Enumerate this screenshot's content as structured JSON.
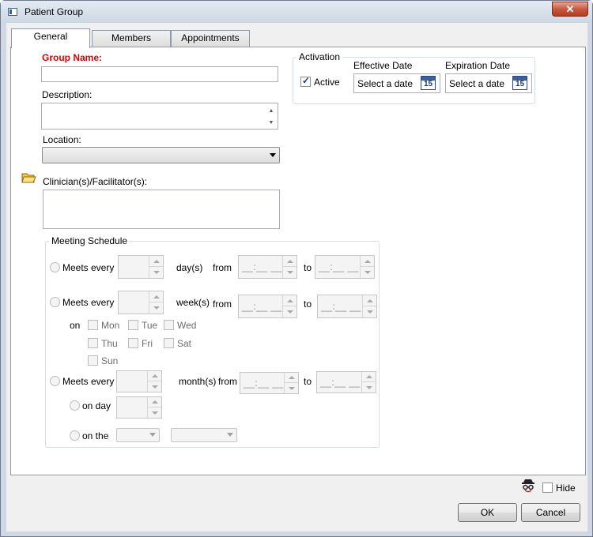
{
  "window": {
    "title": "Patient Group",
    "close_glyph": "✕"
  },
  "tabs": [
    {
      "label": "General"
    },
    {
      "label": "Members"
    },
    {
      "label": "Appointments"
    }
  ],
  "form": {
    "group_name_label": "Group Name:",
    "group_name_value": "",
    "description_label": "Description:",
    "description_value": "",
    "location_label": "Location:",
    "location_value": "",
    "clinicians_label": "Clinician(s)/Facilitator(s):",
    "clinicians_value": ""
  },
  "activation": {
    "title": "Activation",
    "active_label": "Active",
    "active_checked": true,
    "effective_date_label": "Effective Date",
    "expiration_date_label": "Expiration Date",
    "date_placeholder": "Select a date",
    "calendar_day": "15"
  },
  "schedule": {
    "title": "Meeting Schedule",
    "meets_every": "Meets every",
    "days_unit": "day(s)",
    "weeks_unit": "week(s)",
    "months_unit": "month(s)",
    "from": "from",
    "to": "to",
    "on": "on",
    "time_mask": "__:__ __",
    "weekdays": [
      "Mon",
      "Tue",
      "Wed",
      "Thu",
      "Fri",
      "Sat",
      "Sun"
    ],
    "on_day": "on day",
    "on_the": "on the"
  },
  "footer": {
    "hide_label": "Hide",
    "ok_label": "OK",
    "cancel_label": "Cancel"
  },
  "colors": {
    "required_label": "#e00000",
    "window_frame": "#cfd8e4",
    "close_button": "#c75a41"
  }
}
